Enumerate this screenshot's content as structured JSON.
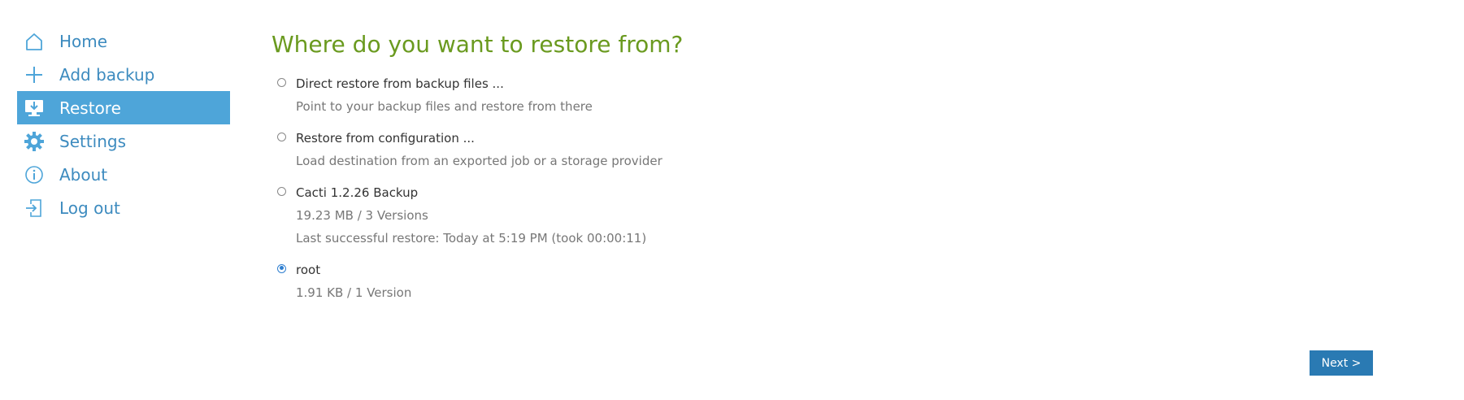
{
  "sidebar": {
    "items": [
      {
        "label": "Home",
        "icon": "home-icon"
      },
      {
        "label": "Add backup",
        "icon": "plus-icon"
      },
      {
        "label": "Restore",
        "icon": "restore-icon",
        "active": true
      },
      {
        "label": "Settings",
        "icon": "gear-icon"
      },
      {
        "label": "About",
        "icon": "info-icon"
      },
      {
        "label": "Log out",
        "icon": "logout-icon"
      }
    ]
  },
  "main": {
    "title": "Where do you want to restore from?",
    "options": [
      {
        "title": "Direct restore from backup files ...",
        "desc": "Point to your backup files and restore from there",
        "selected": false
      },
      {
        "title": "Restore from configuration ...",
        "desc": "Load destination from an exported job or a storage provider",
        "selected": false
      },
      {
        "title": "Cacti 1.2.26 Backup",
        "desc": "19.23 MB / 3 Versions",
        "desc2": "Last successful restore: Today at 5:19 PM (took 00:00:11)",
        "selected": false
      },
      {
        "title": "root",
        "desc": "1.91 KB / 1 Version",
        "selected": true
      }
    ],
    "next_label": "Next >"
  },
  "colors": {
    "accent": "#4ea5d9",
    "nav_text": "#3d8bbf",
    "title": "#6a9a1f",
    "button": "#2a7ab3",
    "radio_selected": "#2f7fd0"
  }
}
